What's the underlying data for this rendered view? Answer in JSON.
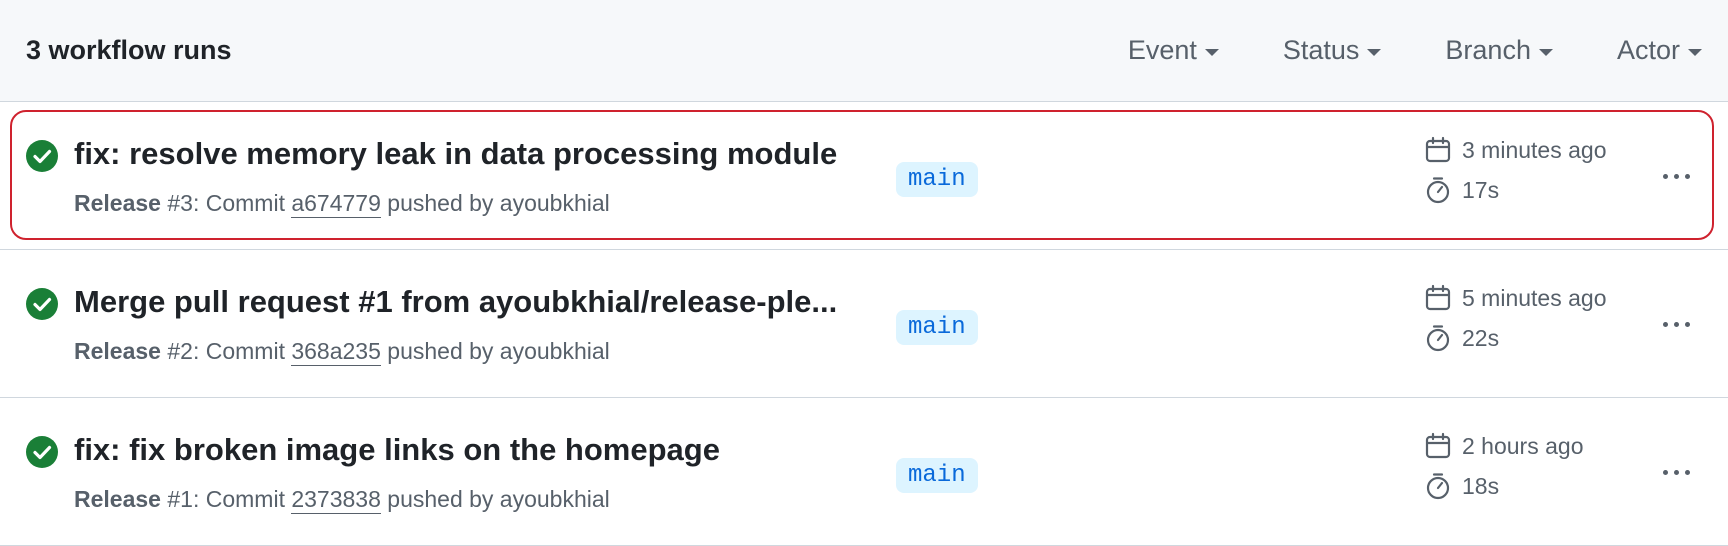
{
  "header": {
    "count_label": "3 workflow runs",
    "filters": [
      {
        "label": "Event"
      },
      {
        "label": "Status"
      },
      {
        "label": "Branch"
      },
      {
        "label": "Actor"
      }
    ]
  },
  "colors": {
    "success": "#1a7f37",
    "branch_bg": "#ddf4ff",
    "branch_text": "#0969da",
    "selection_border": "#cf222e"
  },
  "runs": [
    {
      "status_icon": "check-circle-icon",
      "title": "fix: resolve memory leak in data processing module",
      "workflow": "Release",
      "run_number": "#3",
      "commit_prefix": ": Commit",
      "sha": "a674779",
      "pushed_by": "pushed by ayoubkhial",
      "branch": "main",
      "time_ago": "3 minutes ago",
      "duration": "17s"
    },
    {
      "status_icon": "check-circle-icon",
      "title": "Merge pull request #1 from ayoubkhial/release-ple...",
      "workflow": "Release",
      "run_number": "#2",
      "commit_prefix": ": Commit",
      "sha": "368a235",
      "pushed_by": "pushed by ayoubkhial",
      "branch": "main",
      "time_ago": "5 minutes ago",
      "duration": "22s"
    },
    {
      "status_icon": "check-circle-icon",
      "title": "fix: fix broken image links on the homepage",
      "workflow": "Release",
      "run_number": "#1",
      "commit_prefix": ": Commit",
      "sha": "2373838",
      "pushed_by": "pushed by ayoubkhial",
      "branch": "main",
      "time_ago": "2 hours ago",
      "duration": "18s"
    }
  ]
}
